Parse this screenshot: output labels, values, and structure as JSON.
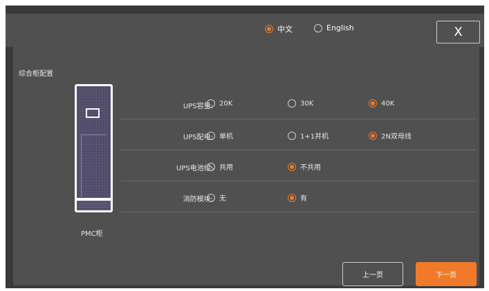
{
  "header": {
    "languages": [
      {
        "label": "中文",
        "selected": true
      },
      {
        "label": "English",
        "selected": false
      }
    ],
    "close_label": "X"
  },
  "section_title": "综合柜配置",
  "cabinet": {
    "label": "PMC柜"
  },
  "config_rows": [
    {
      "label": "UPS容量:",
      "options": [
        {
          "label": "20K",
          "state": "off"
        },
        {
          "label": "30K",
          "state": "off"
        },
        {
          "label": "40K",
          "state": "on"
        }
      ]
    },
    {
      "label": "UPS配电:",
      "options": [
        {
          "label": "单机",
          "state": "off"
        },
        {
          "label": "1+1并机",
          "state": "off"
        },
        {
          "label": "2N双母线",
          "state": "on"
        }
      ]
    },
    {
      "label": "UPS电池组:",
      "options": [
        {
          "label": "共用",
          "state": "disabled"
        },
        {
          "label": "不共用",
          "state": "on"
        }
      ]
    },
    {
      "label": "消防模块:",
      "options": [
        {
          "label": "无",
          "state": "off"
        },
        {
          "label": "有",
          "state": "on"
        }
      ]
    }
  ],
  "buttons": {
    "prev": "上一页",
    "next": "下一页"
  },
  "colors": {
    "accent": "#f07a2a",
    "background": "#3a3a3a",
    "panel": "#505050"
  }
}
